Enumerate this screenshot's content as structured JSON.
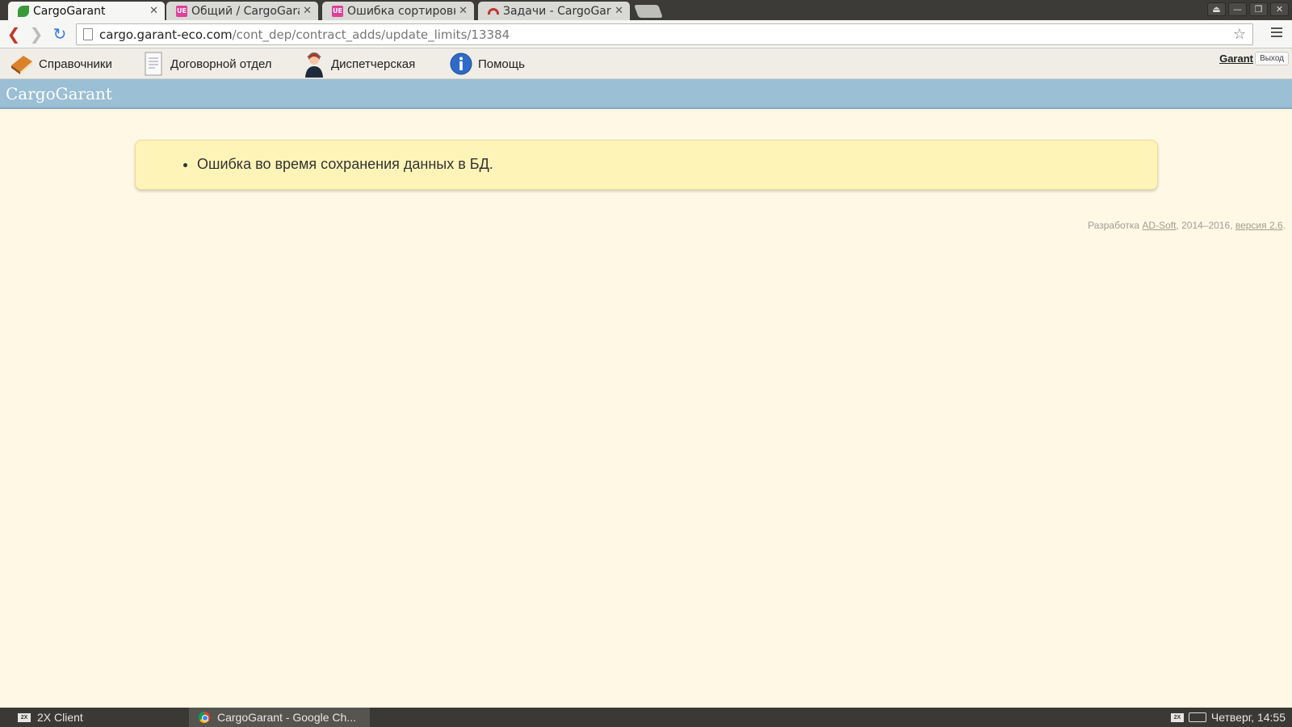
{
  "browser": {
    "tabs": [
      {
        "title": "CargoGarant",
        "favicon": "leaf-icon",
        "active": true
      },
      {
        "title": "Общий / CargoGara",
        "favicon": "ue-icon",
        "active": false
      },
      {
        "title": "Ошибка сортировк",
        "favicon": "ue-icon",
        "active": false
      },
      {
        "title": "Задачи - CargoGara",
        "favicon": "redmine-icon",
        "active": false
      }
    ],
    "url_host": "cargo.garant-eco.com",
    "url_path": "/cont_dep/contract_adds/update_limits/13384"
  },
  "menu": {
    "items": [
      {
        "label": "Справочники",
        "icon": "book-icon"
      },
      {
        "label": "Договорной отдел",
        "icon": "document-icon"
      },
      {
        "label": "Диспетчерская",
        "icon": "dispatcher-icon"
      },
      {
        "label": "Помощь",
        "icon": "info-icon"
      }
    ],
    "user": "Garant",
    "logout": "Выход"
  },
  "brand": "CargoGarant",
  "alert": {
    "messages": [
      "Ошибка во время сохранения данных в БД."
    ]
  },
  "credit": {
    "prefix": "Разработка",
    "company": "AD-Soft",
    "years": ", 2014–2016,",
    "version": "версия 2.6",
    "suffix": "."
  },
  "taskbar": {
    "tasks": [
      "2X Client",
      "CargoGarant - Google Ch..."
    ],
    "clock": "Четверг, 14:55"
  },
  "colors": {
    "page_bg": "#fff8e5",
    "brand_bar": "#9bbfd4",
    "alert_bg": "#fff4b8"
  }
}
